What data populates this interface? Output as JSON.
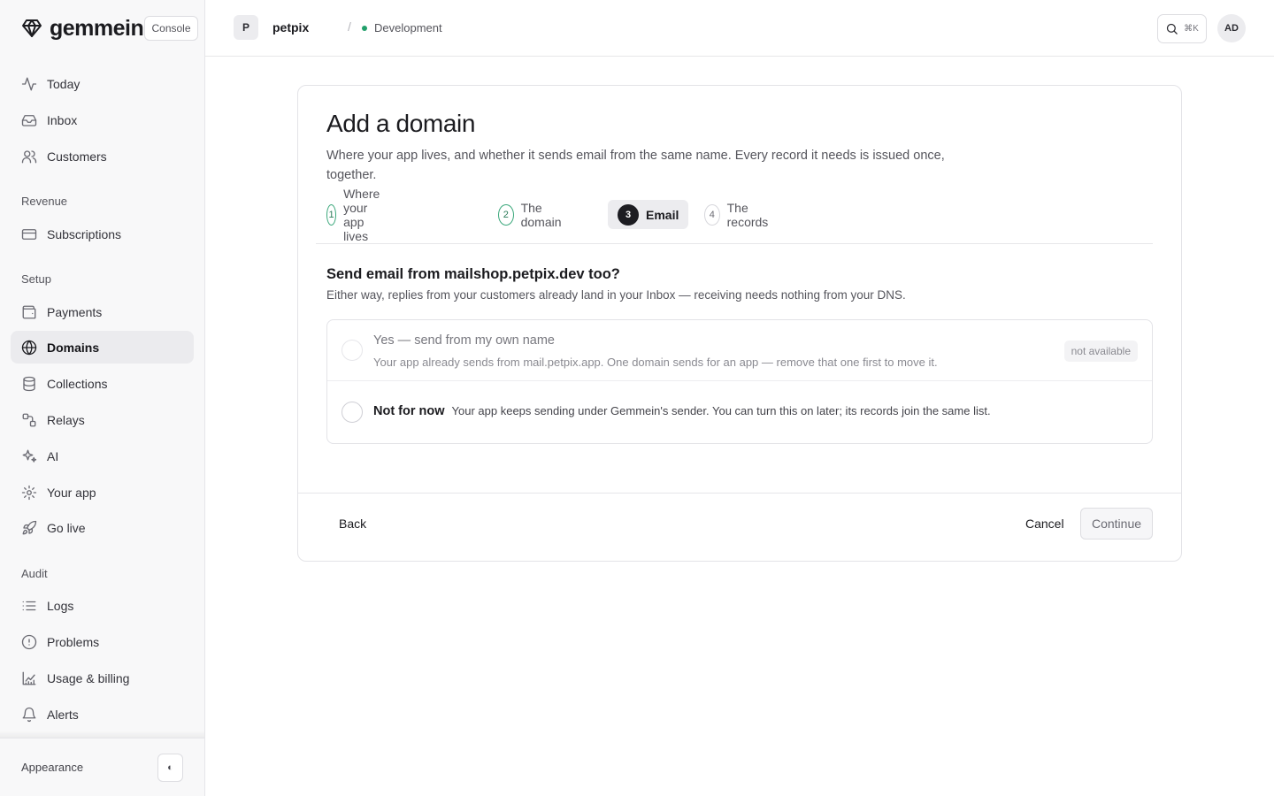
{
  "app": {
    "brand_name": "gemmein",
    "console_label": "Console"
  },
  "sidebar": {
    "primary": [
      {
        "label": "Today",
        "icon": "activity-icon"
      },
      {
        "label": "Inbox",
        "icon": "inbox-icon"
      },
      {
        "label": "Customers",
        "icon": "users-icon"
      }
    ],
    "sections": [
      {
        "title": "Revenue",
        "items": [
          {
            "label": "Subscriptions",
            "icon": "credit-card-icon"
          }
        ]
      },
      {
        "title": "Setup",
        "items": [
          {
            "label": "Payments",
            "icon": "wallet-icon"
          },
          {
            "label": "Domains",
            "icon": "globe-icon",
            "active": true
          },
          {
            "label": "Collections",
            "icon": "database-icon"
          },
          {
            "label": "Relays",
            "icon": "route-icon"
          },
          {
            "label": "AI",
            "icon": "sparkles-icon"
          },
          {
            "label": "Your app",
            "icon": "gear-icon"
          },
          {
            "label": "Go live",
            "icon": "rocket-icon"
          }
        ]
      },
      {
        "title": "Audit",
        "items": [
          {
            "label": "Logs",
            "icon": "list-icon"
          },
          {
            "label": "Problems",
            "icon": "alert-circle-icon"
          },
          {
            "label": "Usage & billing",
            "icon": "chart-icon"
          },
          {
            "label": "Alerts",
            "icon": "bell-icon"
          }
        ]
      }
    ],
    "appearance_label": "Appearance",
    "theme_toggle_glyph": "◐"
  },
  "topbar": {
    "project_initial": "P",
    "project_name": "petpix",
    "separator": "/",
    "environment": "Development",
    "environment_color": "#22a06b",
    "search_shortcut": "⌘K",
    "user_initials": "AD"
  },
  "wizard": {
    "title": "Add a domain",
    "description": "Where your app lives, and whether it sends email from the same name. Every record it needs is issued once, together.",
    "steps": [
      {
        "number": "1",
        "label": "Where your app lives",
        "state": "done"
      },
      {
        "number": "2",
        "label": "The domain",
        "state": "done"
      },
      {
        "number": "3",
        "label": "Email",
        "state": "current"
      },
      {
        "number": "4",
        "label": "The records",
        "state": "upcoming"
      }
    ],
    "question": "Send email from mailshop.petpix.dev too?",
    "question_sub": "Either way, replies from your customers already land in your Inbox — receiving needs nothing from your DNS.",
    "options": [
      {
        "label": "Yes — send from my own name",
        "description": "Your app already sends from mail.petpix.app. One domain sends for an app — remove that one first to move it.",
        "badge": "not available",
        "disabled": true
      },
      {
        "label": "Not for now",
        "description": "Your app keeps sending under Gemmein's sender. You can turn this on later; its records join the same list.",
        "disabled": false
      }
    ],
    "footer": {
      "back_label": "Back",
      "cancel_label": "Cancel",
      "continue_label": "Continue"
    }
  }
}
